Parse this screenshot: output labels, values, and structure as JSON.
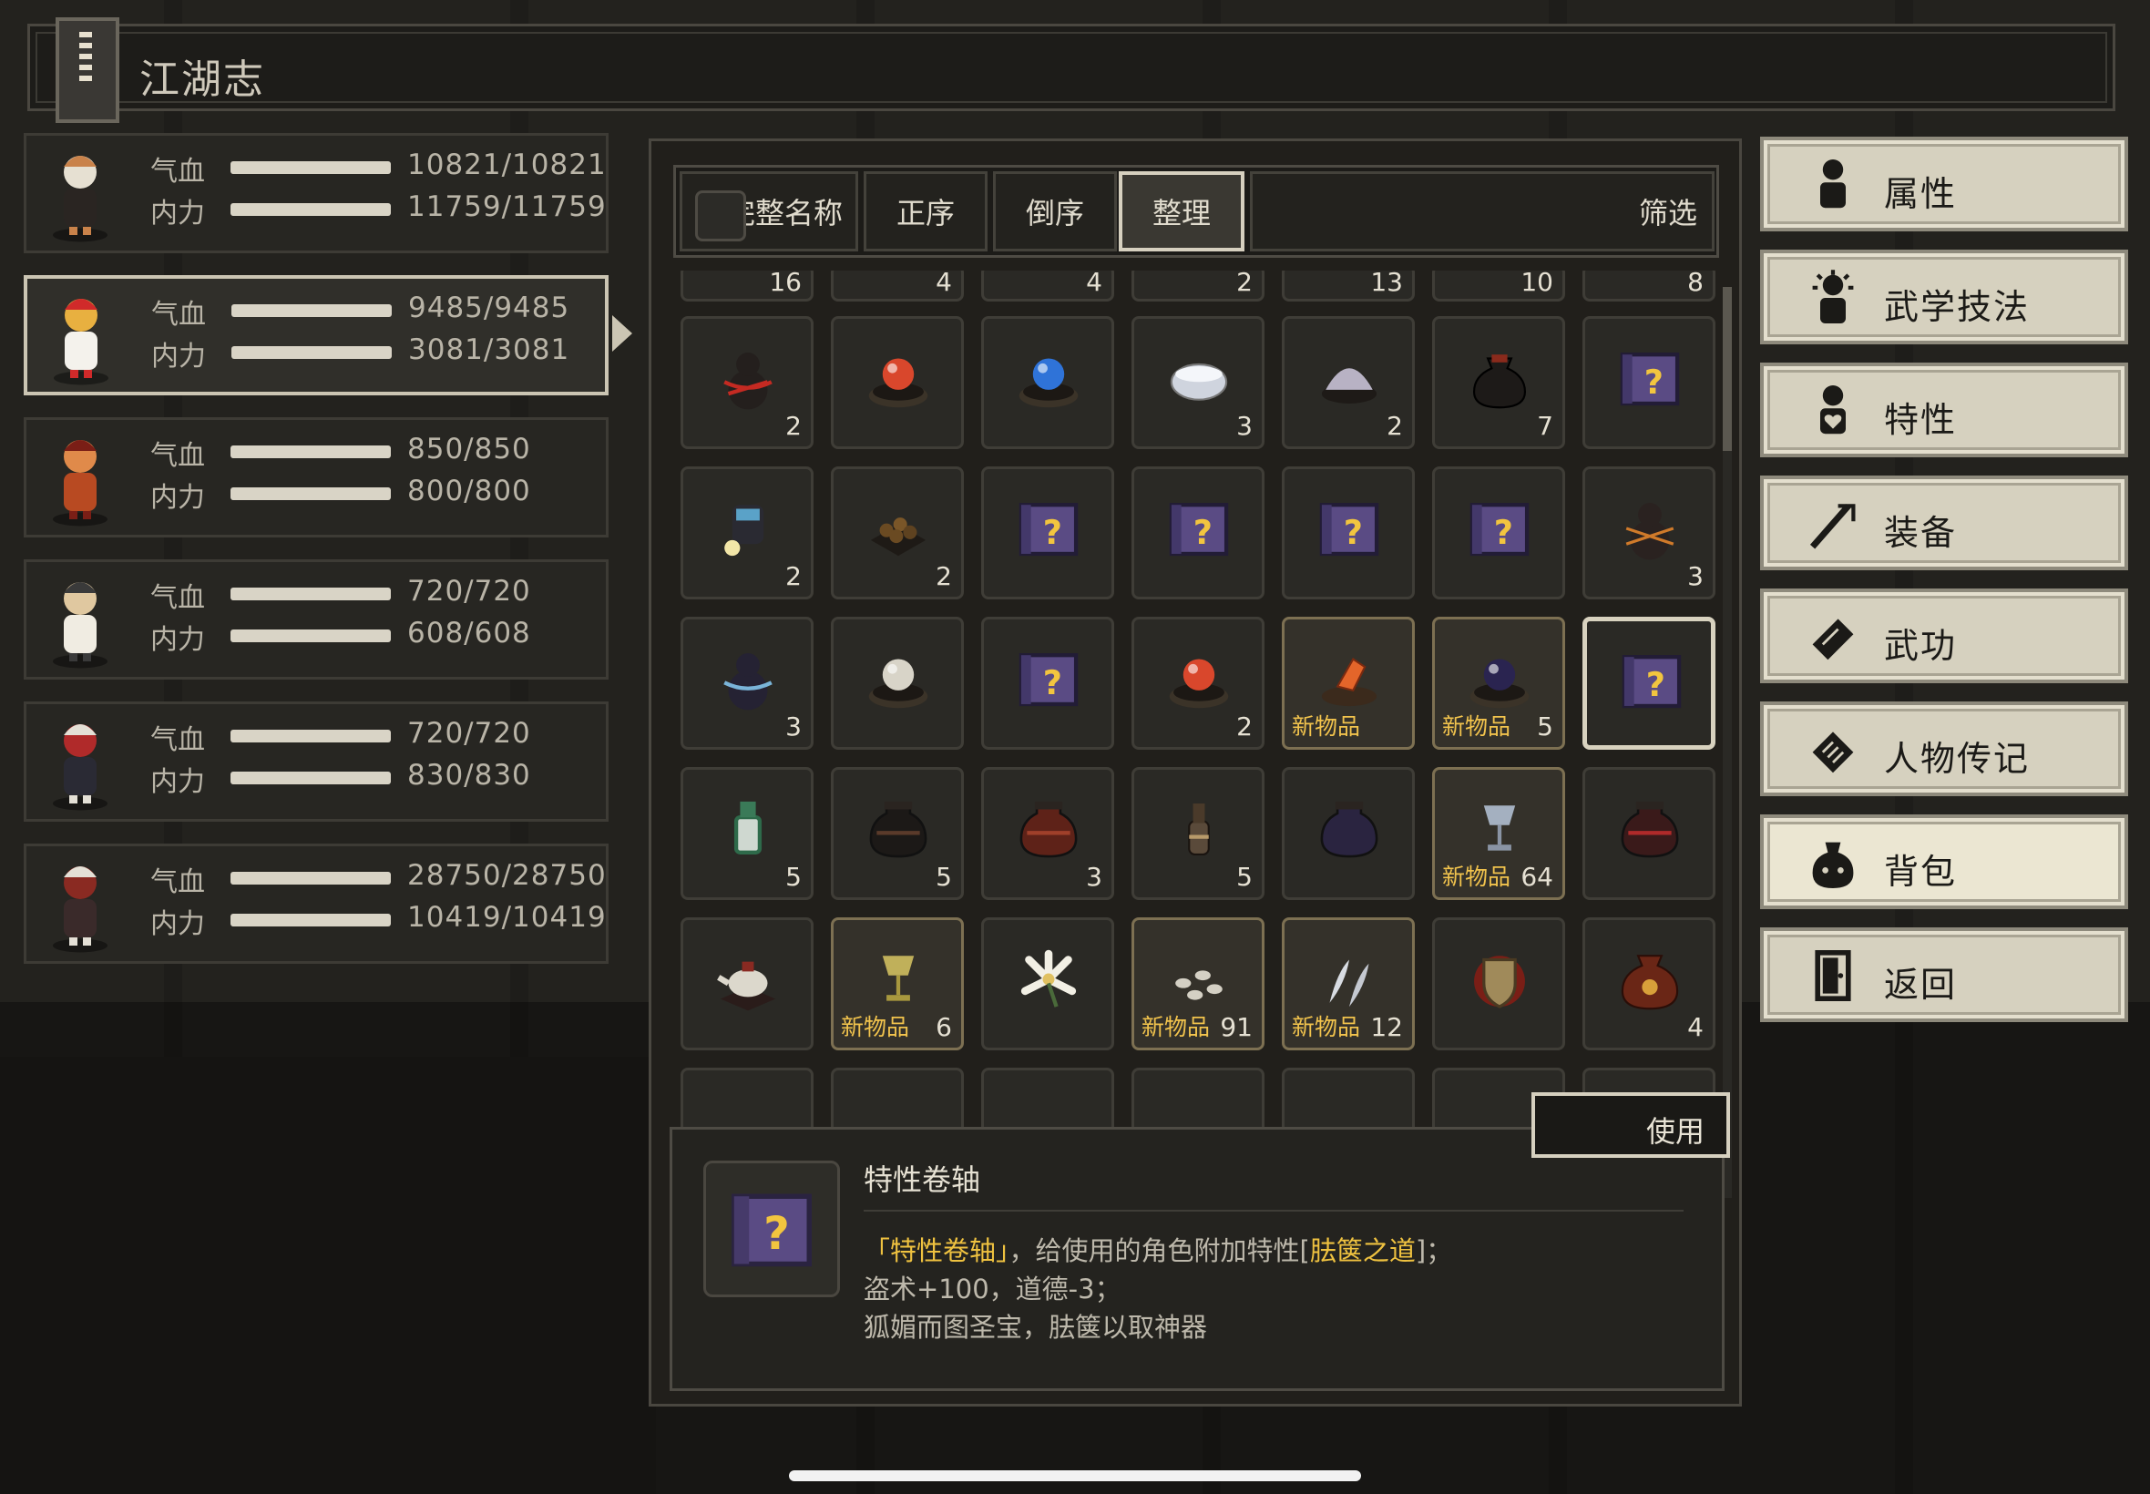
{
  "header": {
    "title": "江湖志"
  },
  "party": [
    {
      "hp_label": "气血",
      "mp_label": "内力",
      "hp": "10821/10821",
      "mp": "11759/11759",
      "avatar": "bandit-hero",
      "selected": false
    },
    {
      "hp_label": "气血",
      "mp_label": "内力",
      "hp": "9485/9485",
      "mp": "3081/3081",
      "avatar": "chicken",
      "selected": true
    },
    {
      "hp_label": "气血",
      "mp_label": "内力",
      "hp": "850/850",
      "mp": "800/800",
      "avatar": "warrior",
      "selected": false
    },
    {
      "hp_label": "气血",
      "mp_label": "内力",
      "hp": "720/720",
      "mp": "608/608",
      "avatar": "monk",
      "selected": false
    },
    {
      "hp_label": "气血",
      "mp_label": "内力",
      "hp": "720/720",
      "mp": "830/830",
      "avatar": "swordsman",
      "selected": false
    },
    {
      "hp_label": "气血",
      "mp_label": "内力",
      "hp": "28750/28750",
      "mp": "10419/10419",
      "avatar": "lady",
      "selected": false
    }
  ],
  "tabs": [
    {
      "label": "完整名称",
      "active": false
    },
    {
      "label": "正序",
      "active": false
    },
    {
      "label": "倒序",
      "active": false
    },
    {
      "label": "整理",
      "active": true
    },
    {
      "label": "筛选",
      "active": false
    }
  ],
  "new_tag": "新物品",
  "top_partial_counts": [
    "16",
    "4",
    "4",
    "2",
    "13",
    "10",
    "8"
  ],
  "rows": [
    [
      {
        "icon": "red-wrapped-gourd-icon",
        "count": "2"
      },
      {
        "icon": "red-pearl-on-stand-icon",
        "count": ""
      },
      {
        "icon": "blue-pearl-on-stand-icon",
        "count": ""
      },
      {
        "icon": "white-bowl-icon",
        "count": "3"
      },
      {
        "icon": "silver-powder-bowl-icon",
        "count": "2"
      },
      {
        "icon": "dark-pouch-icon",
        "count": "7"
      },
      {
        "icon": "trait-scroll-icon",
        "count": ""
      }
    ],
    [
      {
        "icon": "dark-jar-spill-icon",
        "count": "2"
      },
      {
        "icon": "brown-nuggets-icon",
        "count": "2"
      },
      {
        "icon": "trait-scroll-icon",
        "count": ""
      },
      {
        "icon": "trait-scroll-icon",
        "count": ""
      },
      {
        "icon": "trait-scroll-icon",
        "count": ""
      },
      {
        "icon": "trait-scroll-icon",
        "count": ""
      },
      {
        "icon": "dark-gourd-sparkle-icon",
        "count": "3"
      }
    ],
    [
      {
        "icon": "dark-gourd-blue-icon",
        "count": "3"
      },
      {
        "icon": "white-pearl-on-stand-icon",
        "count": ""
      },
      {
        "icon": "trait-scroll-icon",
        "count": ""
      },
      {
        "icon": "red-pearl-stand-sparkle-icon",
        "count": "2"
      },
      {
        "icon": "orange-gem-icon",
        "count": "",
        "new": true
      },
      {
        "icon": "dark-pearl-icon",
        "count": "5",
        "new": true
      },
      {
        "icon": "trait-scroll-icon",
        "count": "",
        "selected": true
      }
    ],
    [
      {
        "icon": "green-bottle-icon",
        "count": "5"
      },
      {
        "icon": "black-jar-icon",
        "count": "5"
      },
      {
        "icon": "red-jar-icon",
        "count": "3"
      },
      {
        "icon": "wine-bottle-icon",
        "count": "5"
      },
      {
        "icon": "purple-jar-icon",
        "count": ""
      },
      {
        "icon": "silver-goblet-icon",
        "count": "64",
        "new": true
      },
      {
        "icon": "red-dark-jar-icon",
        "count": ""
      }
    ],
    [
      {
        "icon": "teapot-icon",
        "count": ""
      },
      {
        "icon": "gold-goblet-icon",
        "count": "6",
        "new": true
      },
      {
        "icon": "white-lily-icon",
        "count": ""
      },
      {
        "icon": "white-stones-icon",
        "count": "91",
        "new": true
      },
      {
        "icon": "silver-leaves-icon",
        "count": "12",
        "new": true
      },
      {
        "icon": "bronze-shield-icon",
        "count": ""
      },
      {
        "icon": "ornate-pouch-icon",
        "count": "4"
      }
    ],
    [
      {
        "icon": "red-herb-icon",
        "count": ""
      },
      {
        "icon": "dark-orb-icon",
        "count": ""
      },
      {
        "icon": "purple-crystal-icon",
        "count": ""
      },
      {
        "icon": "purple-flower-icon",
        "count": ""
      },
      {
        "icon": "blue-gem-icon",
        "count": ""
      },
      {
        "icon": "skull-pile-icon",
        "count": ""
      },
      {
        "icon": "empty-slot-icon",
        "count": ""
      }
    ]
  ],
  "use_button": "使用",
  "detail": {
    "name": "特性卷轴",
    "line1_a": "「特性卷轴」",
    "line1_b": "，给使用的角色附加特性[",
    "line1_c": "胠箧之道",
    "line1_d": "]；",
    "line2": "盗术+100，道德-3；",
    "line3": "狐媚而图圣宝，胠箧以取神器"
  },
  "menu": [
    {
      "label": "属性",
      "icon": "person-icon",
      "active": false
    },
    {
      "label": "武学技法",
      "icon": "sun-person-icon",
      "active": false
    },
    {
      "label": "特性",
      "icon": "heart-person-icon",
      "active": false
    },
    {
      "label": "装备",
      "icon": "sword-icon",
      "active": false
    },
    {
      "label": "武功",
      "icon": "manual-icon",
      "active": false
    },
    {
      "label": "人物传记",
      "icon": "book-icon",
      "active": false
    },
    {
      "label": "背包",
      "icon": "bag-icon",
      "active": true
    },
    {
      "label": "返回",
      "icon": "door-icon",
      "active": false
    }
  ],
  "colors": {
    "accent": "#efc240",
    "panel": "#211f1b",
    "menu": "#d6d1bf"
  }
}
